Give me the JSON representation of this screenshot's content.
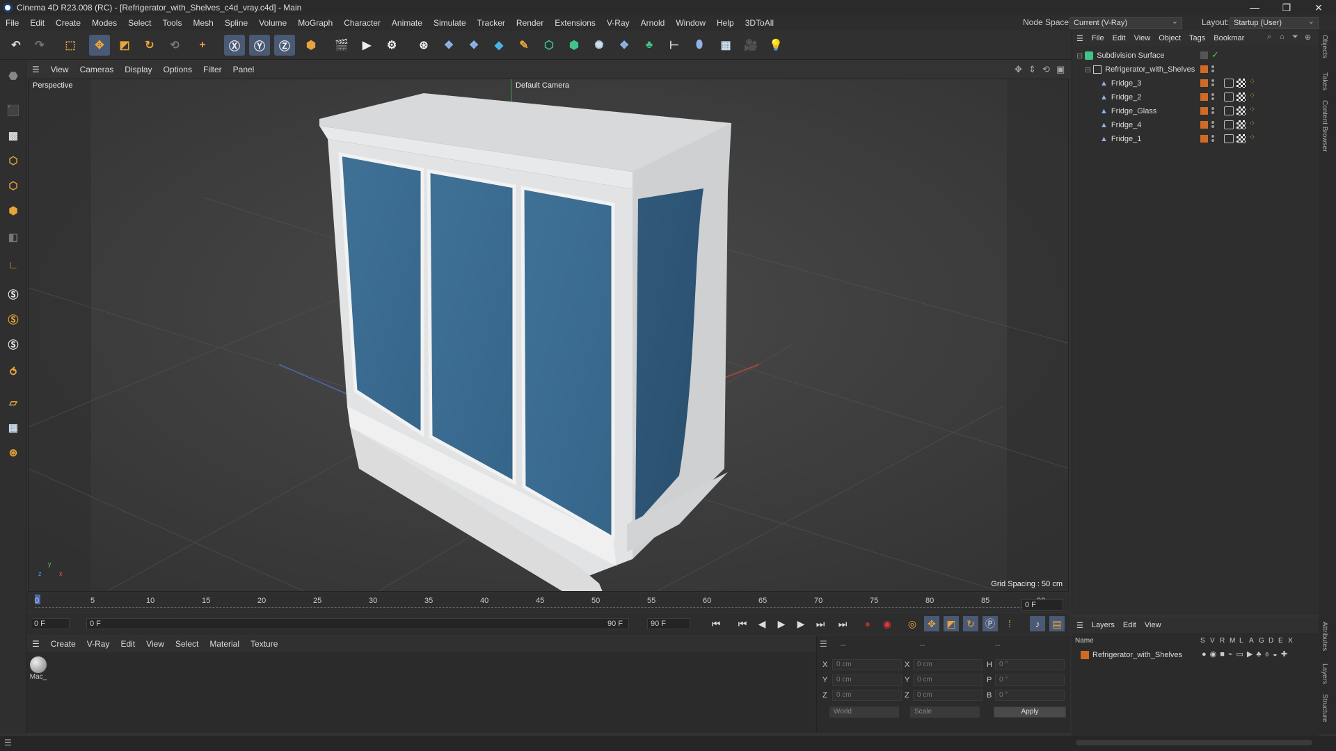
{
  "window": {
    "title": "Cinema 4D R23.008 (RC) - [Refrigerator_with_Shelves_c4d_vray.c4d] - Main"
  },
  "menu": [
    "File",
    "Edit",
    "Create",
    "Modes",
    "Select",
    "Tools",
    "Mesh",
    "Spline",
    "Volume",
    "MoGraph",
    "Character",
    "Animate",
    "Simulate",
    "Tracker",
    "Render",
    "Extensions",
    "V-Ray",
    "Arnold",
    "Window",
    "Help",
    "3DToAll"
  ],
  "header_right": {
    "node_space_label": "Node Space:",
    "node_space_value": "Current (V-Ray)",
    "layout_label": "Layout:",
    "layout_value": "Startup (User)"
  },
  "viewport": {
    "menu": [
      "View",
      "Cameras",
      "Display",
      "Options",
      "Filter",
      "Panel"
    ],
    "label": "Perspective",
    "camera": "Default Camera",
    "grid_spacing": "Grid Spacing : 50 cm",
    "axis_labels": {
      "y": "y",
      "z": "z",
      "x": "x"
    }
  },
  "timeline": {
    "ticks": [
      "0",
      "5",
      "10",
      "15",
      "20",
      "25",
      "30",
      "35",
      "40",
      "45",
      "50",
      "55",
      "60",
      "65",
      "70",
      "75",
      "80",
      "85",
      "90"
    ],
    "current_frame": "0 F"
  },
  "transport": {
    "start": "0 F",
    "range_start": "0 F",
    "range_end": "90 F",
    "end": "90 F"
  },
  "material_manager": {
    "menu": [
      "Create",
      "V-Ray",
      "Edit",
      "View",
      "Select",
      "Material",
      "Texture"
    ],
    "materials": [
      {
        "label": "Mac_"
      }
    ]
  },
  "coordinates": {
    "rows": [
      {
        "a": "X",
        "av": "0 cm",
        "b": "X",
        "bv": "0 cm",
        "c": "H",
        "cv": "0 °"
      },
      {
        "a": "Y",
        "av": "0 cm",
        "b": "Y",
        "bv": "0 cm",
        "c": "P",
        "cv": "0 °"
      },
      {
        "a": "Z",
        "av": "0 cm",
        "b": "Z",
        "bv": "0 cm",
        "c": "B",
        "cv": "0 °"
      }
    ],
    "header_a": "--",
    "header_b": "--",
    "header_c": "--",
    "mode_world": "World",
    "mode_scale": "Scale",
    "apply": "Apply"
  },
  "object_manager": {
    "menu": [
      "File",
      "Edit",
      "View",
      "Object",
      "Tags",
      "Bookmar"
    ],
    "objects": [
      {
        "name": "Subdivision Surface",
        "indent": 0
      },
      {
        "name": "Refrigerator_with_Shelves",
        "indent": 1
      },
      {
        "name": "Fridge_3",
        "indent": 2
      },
      {
        "name": "Fridge_2",
        "indent": 2
      },
      {
        "name": "Fridge_Glass",
        "indent": 2
      },
      {
        "name": "Fridge_4",
        "indent": 2
      },
      {
        "name": "Fridge_1",
        "indent": 2
      }
    ]
  },
  "layers": {
    "menu": [
      "Layers",
      "Edit",
      "View"
    ],
    "col_name": "Name",
    "cols": [
      "S",
      "V",
      "R",
      "M",
      "L",
      "A",
      "G",
      "D",
      "E",
      "X"
    ],
    "items": [
      {
        "name": "Refrigerator_with_Shelves"
      }
    ]
  },
  "side_tabs": [
    "Objects",
    "Takes",
    "Content Browser",
    "Attributes",
    "Layers",
    "Structure"
  ],
  "colors": {
    "accent": "#4a5a75",
    "glass": "#3f7196",
    "orange": "#d06a25"
  }
}
